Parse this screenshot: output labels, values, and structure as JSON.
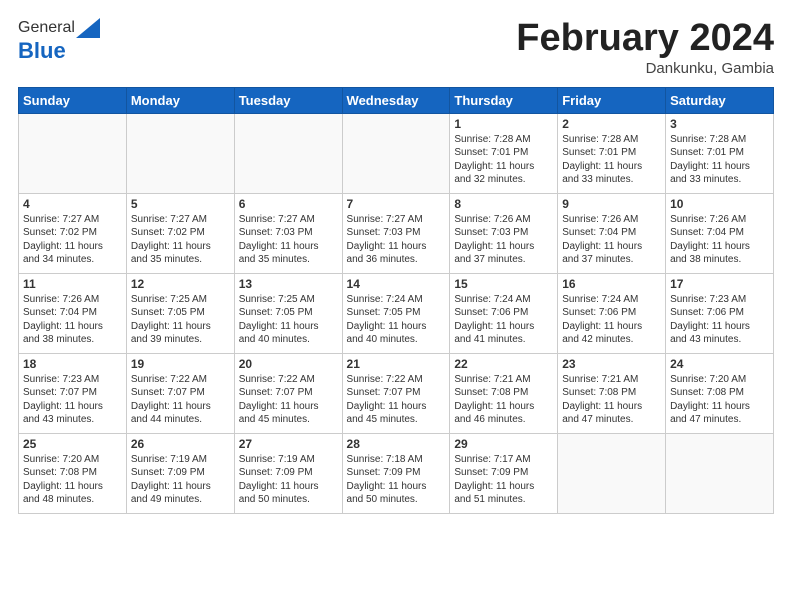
{
  "header": {
    "logo_general": "General",
    "logo_blue": "Blue",
    "month_title": "February 2024",
    "location": "Dankunku, Gambia"
  },
  "weekdays": [
    "Sunday",
    "Monday",
    "Tuesday",
    "Wednesday",
    "Thursday",
    "Friday",
    "Saturday"
  ],
  "weeks": [
    [
      {
        "day": "",
        "info": ""
      },
      {
        "day": "",
        "info": ""
      },
      {
        "day": "",
        "info": ""
      },
      {
        "day": "",
        "info": ""
      },
      {
        "day": "1",
        "info": "Sunrise: 7:28 AM\nSunset: 7:01 PM\nDaylight: 11 hours\nand 32 minutes."
      },
      {
        "day": "2",
        "info": "Sunrise: 7:28 AM\nSunset: 7:01 PM\nDaylight: 11 hours\nand 33 minutes."
      },
      {
        "day": "3",
        "info": "Sunrise: 7:28 AM\nSunset: 7:01 PM\nDaylight: 11 hours\nand 33 minutes."
      }
    ],
    [
      {
        "day": "4",
        "info": "Sunrise: 7:27 AM\nSunset: 7:02 PM\nDaylight: 11 hours\nand 34 minutes."
      },
      {
        "day": "5",
        "info": "Sunrise: 7:27 AM\nSunset: 7:02 PM\nDaylight: 11 hours\nand 35 minutes."
      },
      {
        "day": "6",
        "info": "Sunrise: 7:27 AM\nSunset: 7:03 PM\nDaylight: 11 hours\nand 35 minutes."
      },
      {
        "day": "7",
        "info": "Sunrise: 7:27 AM\nSunset: 7:03 PM\nDaylight: 11 hours\nand 36 minutes."
      },
      {
        "day": "8",
        "info": "Sunrise: 7:26 AM\nSunset: 7:03 PM\nDaylight: 11 hours\nand 37 minutes."
      },
      {
        "day": "9",
        "info": "Sunrise: 7:26 AM\nSunset: 7:04 PM\nDaylight: 11 hours\nand 37 minutes."
      },
      {
        "day": "10",
        "info": "Sunrise: 7:26 AM\nSunset: 7:04 PM\nDaylight: 11 hours\nand 38 minutes."
      }
    ],
    [
      {
        "day": "11",
        "info": "Sunrise: 7:26 AM\nSunset: 7:04 PM\nDaylight: 11 hours\nand 38 minutes."
      },
      {
        "day": "12",
        "info": "Sunrise: 7:25 AM\nSunset: 7:05 PM\nDaylight: 11 hours\nand 39 minutes."
      },
      {
        "day": "13",
        "info": "Sunrise: 7:25 AM\nSunset: 7:05 PM\nDaylight: 11 hours\nand 40 minutes."
      },
      {
        "day": "14",
        "info": "Sunrise: 7:24 AM\nSunset: 7:05 PM\nDaylight: 11 hours\nand 40 minutes."
      },
      {
        "day": "15",
        "info": "Sunrise: 7:24 AM\nSunset: 7:06 PM\nDaylight: 11 hours\nand 41 minutes."
      },
      {
        "day": "16",
        "info": "Sunrise: 7:24 AM\nSunset: 7:06 PM\nDaylight: 11 hours\nand 42 minutes."
      },
      {
        "day": "17",
        "info": "Sunrise: 7:23 AM\nSunset: 7:06 PM\nDaylight: 11 hours\nand 43 minutes."
      }
    ],
    [
      {
        "day": "18",
        "info": "Sunrise: 7:23 AM\nSunset: 7:07 PM\nDaylight: 11 hours\nand 43 minutes."
      },
      {
        "day": "19",
        "info": "Sunrise: 7:22 AM\nSunset: 7:07 PM\nDaylight: 11 hours\nand 44 minutes."
      },
      {
        "day": "20",
        "info": "Sunrise: 7:22 AM\nSunset: 7:07 PM\nDaylight: 11 hours\nand 45 minutes."
      },
      {
        "day": "21",
        "info": "Sunrise: 7:22 AM\nSunset: 7:07 PM\nDaylight: 11 hours\nand 45 minutes."
      },
      {
        "day": "22",
        "info": "Sunrise: 7:21 AM\nSunset: 7:08 PM\nDaylight: 11 hours\nand 46 minutes."
      },
      {
        "day": "23",
        "info": "Sunrise: 7:21 AM\nSunset: 7:08 PM\nDaylight: 11 hours\nand 47 minutes."
      },
      {
        "day": "24",
        "info": "Sunrise: 7:20 AM\nSunset: 7:08 PM\nDaylight: 11 hours\nand 47 minutes."
      }
    ],
    [
      {
        "day": "25",
        "info": "Sunrise: 7:20 AM\nSunset: 7:08 PM\nDaylight: 11 hours\nand 48 minutes."
      },
      {
        "day": "26",
        "info": "Sunrise: 7:19 AM\nSunset: 7:09 PM\nDaylight: 11 hours\nand 49 minutes."
      },
      {
        "day": "27",
        "info": "Sunrise: 7:19 AM\nSunset: 7:09 PM\nDaylight: 11 hours\nand 50 minutes."
      },
      {
        "day": "28",
        "info": "Sunrise: 7:18 AM\nSunset: 7:09 PM\nDaylight: 11 hours\nand 50 minutes."
      },
      {
        "day": "29",
        "info": "Sunrise: 7:17 AM\nSunset: 7:09 PM\nDaylight: 11 hours\nand 51 minutes."
      },
      {
        "day": "",
        "info": ""
      },
      {
        "day": "",
        "info": ""
      }
    ]
  ]
}
